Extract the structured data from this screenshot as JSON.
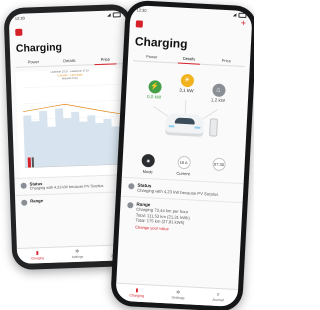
{
  "status_bar": {
    "time_back": "12:30",
    "time_front": "12:30"
  },
  "back_phone": {
    "title": "Charging",
    "tabs": [
      "Power",
      "Details",
      "Price"
    ],
    "active_tab": 2,
    "chart_header_line1": "Laadstart 13:10 · Laadeinde 17:19",
    "chart_header_line2": "0,34 kWh · 0,82 €/kWh",
    "chart_header_line3": "Aktueller Preis",
    "status": {
      "title": "Status",
      "text": "Charging with 4,23 kW because PV Surplus"
    },
    "range": {
      "title": "Range"
    },
    "nav": [
      "Charging",
      "Settings",
      "Journal"
    ]
  },
  "front_phone": {
    "title": "Charging",
    "tabs": [
      "Power",
      "Details",
      "Price"
    ],
    "active_tab": 1,
    "flow": {
      "solar_value": "3,1 kW",
      "grid_value": "0,0 kW",
      "house_value": "1,2 kW"
    },
    "controls": [
      {
        "label": "Mode",
        "value": ""
      },
      {
        "label": "Current",
        "value": "16 A"
      },
      {
        "label": "",
        "value": "07:30"
      }
    ],
    "status": {
      "title": "Status",
      "text": "Charging with 4,23 kW because PV Surplus"
    },
    "range": {
      "title": "Range",
      "line1": "Charging 73,44 km per hour",
      "line2": "Total: 111,53 km (21,31 kWh)",
      "line3": "Total: 175 km (27,91 kWh)",
      "link": "Change your value"
    },
    "nav": [
      "Charging",
      "Settings",
      "Journal"
    ]
  },
  "colors": {
    "brand": "#d7212a",
    "solar": "#f1b21c",
    "grid": "#43a047",
    "house": "#8a8f95",
    "price_line": "#e08a1e",
    "bar_fill": "#d7e4ef"
  },
  "icons": {
    "solar": "sun-icon",
    "grid": "pylon-icon",
    "house": "home-icon",
    "mode": "mode-icon",
    "status": "info-icon",
    "range": "location-icon"
  }
}
